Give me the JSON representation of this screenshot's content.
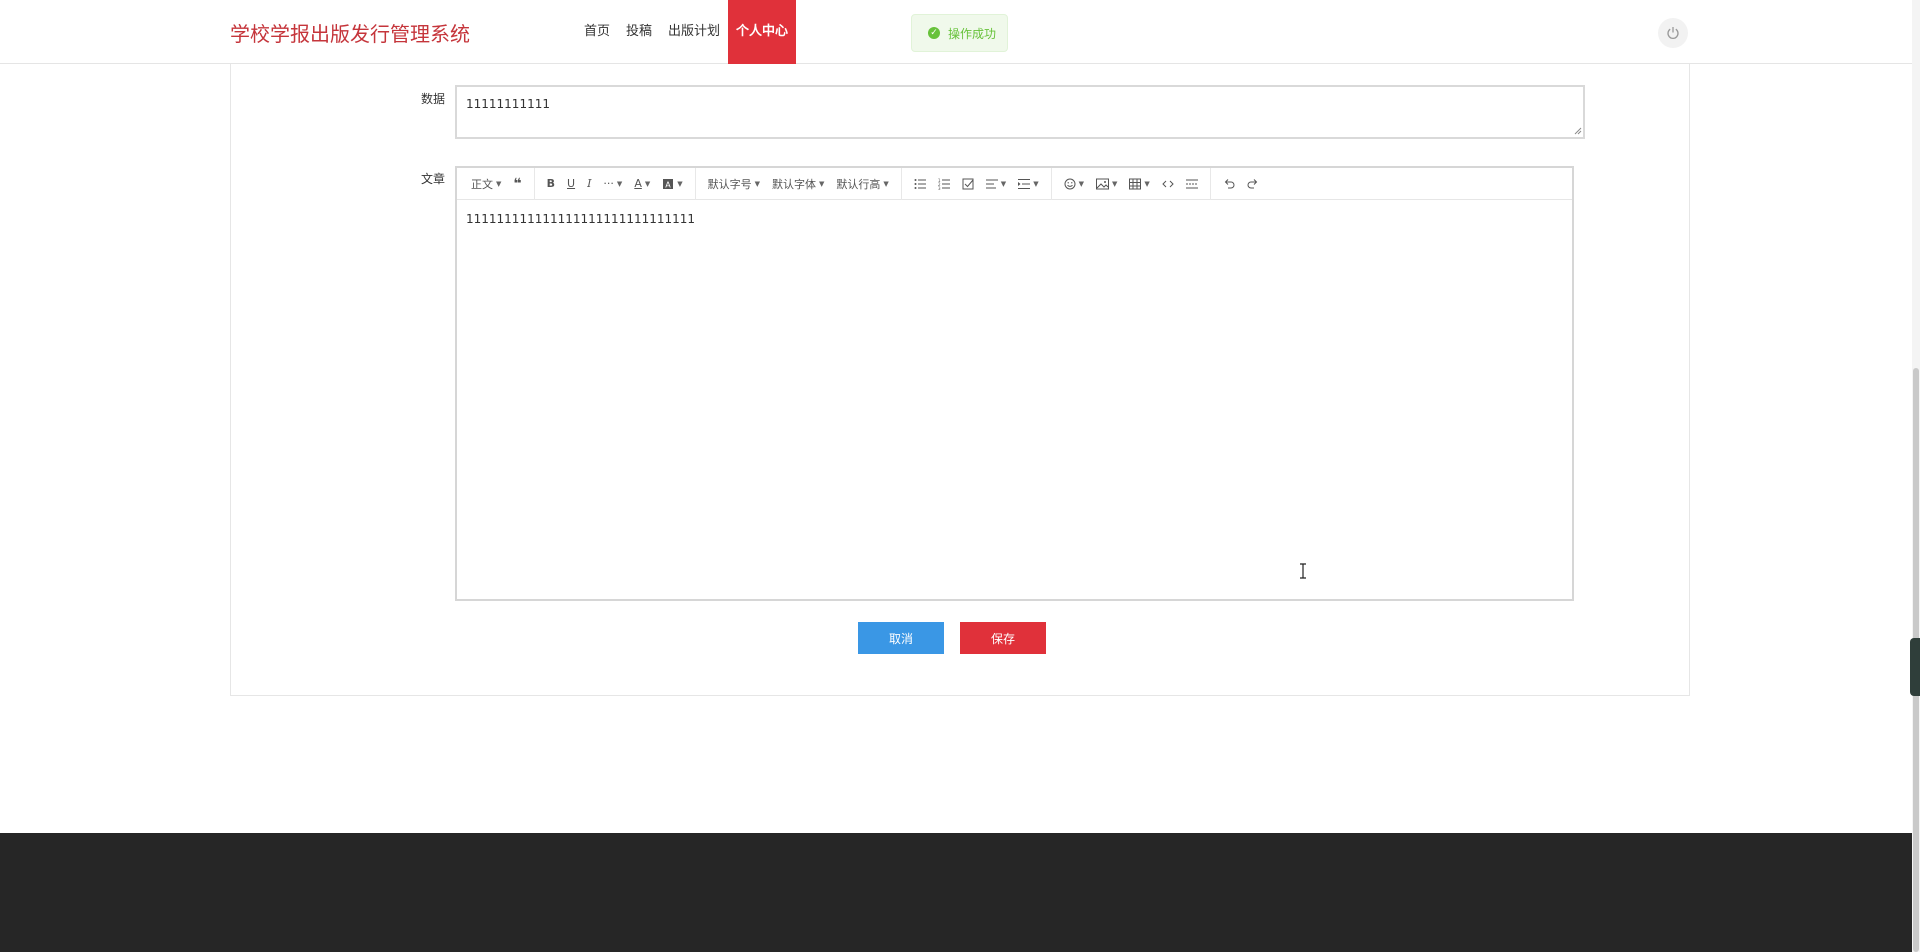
{
  "header": {
    "brand": "学校学报出版发行管理系统",
    "nav": [
      "首页",
      "投稿",
      "出版计划",
      "个人中心"
    ],
    "active_nav": "个人中心",
    "toast": "操作成功",
    "power_icon": "power-icon"
  },
  "form": {
    "data_label": "数据",
    "data_value": "11111111111",
    "article_label": "文章",
    "article_content": "111111111111111111111111111111"
  },
  "toolbar": {
    "paragraph": "正文",
    "font_size": "默认字号",
    "font_family": "默认字体",
    "line_height": "默认行高"
  },
  "buttons": {
    "cancel": "取消",
    "save": "保存"
  },
  "colors": {
    "brand": "#c5353b",
    "accent": "#e0313a",
    "cancel": "#3a97e5",
    "success": "#67c23a",
    "footer": "#262626"
  }
}
